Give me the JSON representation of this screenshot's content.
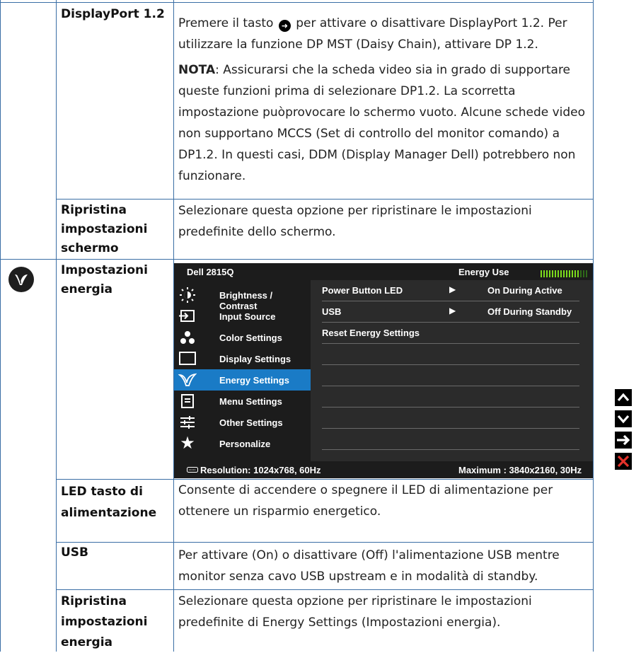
{
  "rows": {
    "displayport": {
      "label": "DisplayPort 1.2",
      "text_before_icon": "Premere il tasto",
      "text_after_icon": "per attivare o disattivare DisplayPort 1.2. Per utilizzare la funzione DP MST (Daisy Chain), attivare DP 1.2.",
      "note_label": "NOTA",
      "note_text": ": Assicurarsi che la scheda video sia in grado di supportare queste funzioni prima di selezionare DP1.2. La scorretta impostazione puòprovocare lo schermo vuoto. Alcune schede video non supportano MCCS (Set di controllo del monitor comando) a DP1.2. In questi casi, DDM (Display Manager Dell) potrebbero non funzionare."
    },
    "reset_screen": {
      "label": "Ripristina impostazioni schermo",
      "text": "Selezionare questa opzione per ripristinare le impostazioni predefinite dello schermo."
    },
    "energy": {
      "label": "Impostazioni energia"
    },
    "power_led": {
      "label": "LED tasto di alimentazione",
      "text": "Consente di accendere o spegnere il LED di alimentazione per ottenere un risparmio energetico."
    },
    "usb": {
      "label": "USB",
      "text": "Per attivare (On) o disattivare (Off) l'alimentazione USB mentre monitor senza cavo USB upstream e in modalità di standby."
    },
    "reset_energy": {
      "label": "Ripristina impostazioni energia",
      "text": "Selezionare questa opzione per ripristinare le impostazioni predefinite di Energy Settings (Impostazioni energia)."
    }
  },
  "osd": {
    "model": "Dell 2815Q",
    "energy_use_label": "Energy Use",
    "energy_use_level": 0.8,
    "menu": [
      {
        "label": "Brightness / Contrast",
        "icon": "brightness-icon"
      },
      {
        "label": "Input Source",
        "icon": "input-source-icon"
      },
      {
        "label": "Color Settings",
        "icon": "color-settings-icon"
      },
      {
        "label": "Display Settings",
        "icon": "display-settings-icon"
      },
      {
        "label": "Energy Settings",
        "icon": "energy-icon",
        "selected": true
      },
      {
        "label": "Menu Settings",
        "icon": "menu-settings-icon"
      },
      {
        "label": "Other Settings",
        "icon": "other-settings-icon"
      },
      {
        "label": "Personalize",
        "icon": "star-icon"
      }
    ],
    "submenu": [
      {
        "name": "Power Button LED",
        "value": "On During Active"
      },
      {
        "name": "USB",
        "value": "Off During Standby"
      },
      {
        "name": "Reset Energy Settings",
        "value": ""
      }
    ],
    "resolution": "Resolution: 1024x768,  60Hz",
    "maximum": "Maximum : 3840x2160,  30Hz"
  },
  "nav_buttons": [
    "up-arrow-icon",
    "down-arrow-icon",
    "right-arrow-icon",
    "close-icon"
  ],
  "colors": {
    "grid": "#3a6ea5",
    "osd_bg": "#1c1c1c",
    "osd_selected": "#1a7bc6",
    "energy_bar": "#7cdc1c",
    "close_red": "#e4322b"
  }
}
